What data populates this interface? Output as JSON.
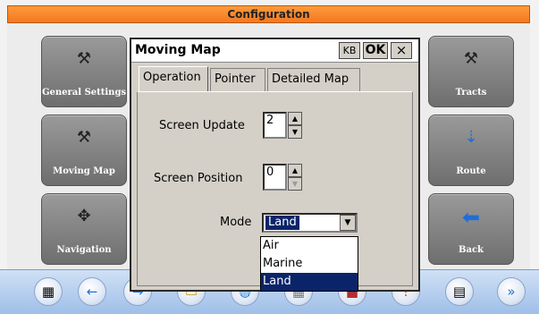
{
  "app": {
    "title": "Configuration"
  },
  "tiles": [
    {
      "label": "General Settings",
      "icon": "tools-icon"
    },
    {
      "label": "Moving Map",
      "icon": "tools-icon"
    },
    {
      "label": "Navigation",
      "icon": "navigation-icon"
    },
    {
      "label": "Tracts",
      "icon": "tools-icon"
    },
    {
      "label": "Route",
      "icon": "route-icon"
    },
    {
      "label": "Back",
      "icon": "back-arrow-icon"
    }
  ],
  "dialog": {
    "title": "Moving Map",
    "kb_label": "KB",
    "ok_label": "OK",
    "close_label": "×",
    "tabs": [
      "Operation",
      "Pointer",
      "Detailed Map"
    ],
    "active_tab": "Operation",
    "screen_update": {
      "label": "Screen Update",
      "value": "2"
    },
    "screen_position": {
      "label": "Screen Position",
      "value": "0"
    },
    "mode": {
      "label": "Mode",
      "value": "Land",
      "options": [
        "Air",
        "Marine",
        "Land"
      ]
    }
  },
  "toolbar": {
    "icons": [
      "layers-icon",
      "back-arrow-icon",
      "forward-arrow-icon",
      "folder-icon",
      "globe-icon",
      "grid-icon",
      "save-icon",
      "flag-icon",
      "document-icon",
      "more-icon"
    ],
    "glyphs": [
      "▦",
      "←",
      "→",
      "▭",
      "◍",
      "▦",
      "■",
      "!",
      "▤",
      "»"
    ]
  }
}
